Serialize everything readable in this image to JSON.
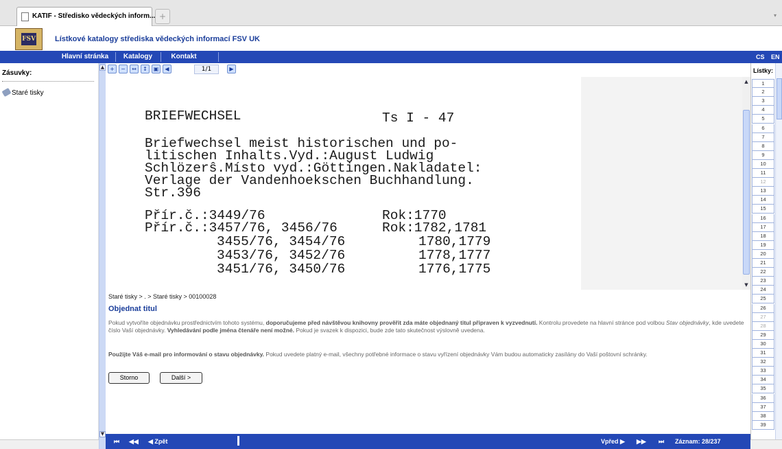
{
  "browser": {
    "tab_title": "KATIF - Středisko vědeckých inform...",
    "new_tab": "+"
  },
  "header": {
    "logo_text": "FSV",
    "title": "Lístkové katalogy střediska vědeckých informací FSV UK"
  },
  "nav": {
    "items": [
      "Hlavní stránka",
      "Katalogy",
      "Kontakt"
    ],
    "lang_cs": "CS",
    "lang_en": "EN"
  },
  "sidebar": {
    "heading": "Zásuvky:",
    "item": "Staré tisky"
  },
  "toolbar": {
    "page_indicator": "1/1"
  },
  "card": {
    "lines": [
      "BRIEFWECHSEL",
      "Ts I - 47",
      "Briefwechsel meist historischen und po-",
      "litischen Inhalts.Vyd.:August Ludwig",
      "Schlözerŝ.Místo vyd.:Göttingen.Nakladatel:",
      "Verlage der Vandenhoekschen Buchhandlung.",
      "Str.396",
      "Přír.č.:3449/76",
      "Rok:1770",
      "Přír.č.:3457/76, 3456/76",
      "Rok:1782,1781",
      "3455/76, 3454/76",
      "1780,1779",
      "3453/76, 3452/76",
      "1778,1777",
      "3451/76, 3450/76",
      "1776,1775"
    ]
  },
  "breadcrumb": "Staré tisky > . > Staré tisky > 00100028",
  "order": {
    "title": "Objednat titul",
    "p1a": "Pokud vytvoříte objednávku prostřednictvím tohoto systému, ",
    "p1b": "doporučujeme před návštěvou knihovny prověřit zda máte objednaný titul připraven k vyzvednutí.",
    "p1c": " Kontrolu provedete na hlavní stránce pod volbou ",
    "p1d": "Stav objednávky",
    "p1e": ", kde uvedete číslo Vaší objednávky. ",
    "p1f": "Vyhledávání podle jména čtenáře není možné.",
    "p1g": " Pokud je svazek k dispozici, bude zde tato skutečnost výslovně uvedena.",
    "p2a": "Použijte Váš e-mail pro informování o stavu objednávky.",
    "p2b": " Pokud uvedete platný e-mail, všechny potřebné informace o stavu vyřízení objednávky Vám budou automaticky zasílány do Vaší poštovní schránky.",
    "btn_cancel": "Storno",
    "btn_next": "Další >"
  },
  "bottom": {
    "first": "⏮",
    "prev_fast": "◀◀",
    "prev": "◀ Zpět",
    "next": "Vpřed ▶",
    "next_fast": "▶▶",
    "last": "⏭",
    "record": "Záznam: 28/237"
  },
  "listky": {
    "label": "Lístky:",
    "numbers": [
      "1",
      "2",
      "3",
      "4",
      "5",
      "6",
      "7",
      "8",
      "9",
      "10",
      "11",
      "12",
      "13",
      "14",
      "15",
      "16",
      "17",
      "18",
      "19",
      "20",
      "21",
      "22",
      "23",
      "24",
      "25",
      "26",
      "27",
      "28",
      "29",
      "30",
      "31",
      "32",
      "33",
      "34",
      "35",
      "36",
      "37",
      "38",
      "39"
    ],
    "disabled": [
      "12",
      "27",
      "28"
    ]
  }
}
